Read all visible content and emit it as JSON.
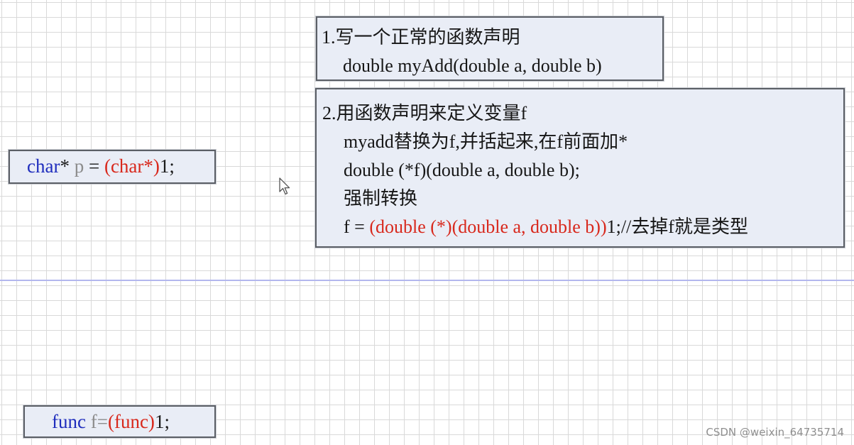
{
  "code_char": {
    "type": "char",
    "star": "*",
    "var": "p",
    "eq": " = ",
    "cast": "(char*)",
    "rest": "1;"
  },
  "code_func": {
    "type": "func",
    "var": "f",
    "eq": "=",
    "cast": "(func)",
    "rest": "1;"
  },
  "note1": {
    "heading": "1.写一个正常的函数声明",
    "line1": "double myAdd(double a, double b)"
  },
  "note2": {
    "heading": "2.用函数声明来定义变量f",
    "line1": "myadd替换为f,并括起来,在f前面加*",
    "line2": "double (*f)(double a, double b);",
    "line3": "强制转换",
    "line4_prefix": "f = ",
    "line4_cast": "(double (*)(double a, double b))",
    "line4_suffix": "1;//去掉f就是类型"
  },
  "watermark": "CSDN @weixin_64735714",
  "colors": {
    "keyword": "#1f2dbd",
    "variable": "#8c8c8c",
    "cast": "#d8281c",
    "box_background": "#e9edf6",
    "divider": "#b3b7ee"
  }
}
